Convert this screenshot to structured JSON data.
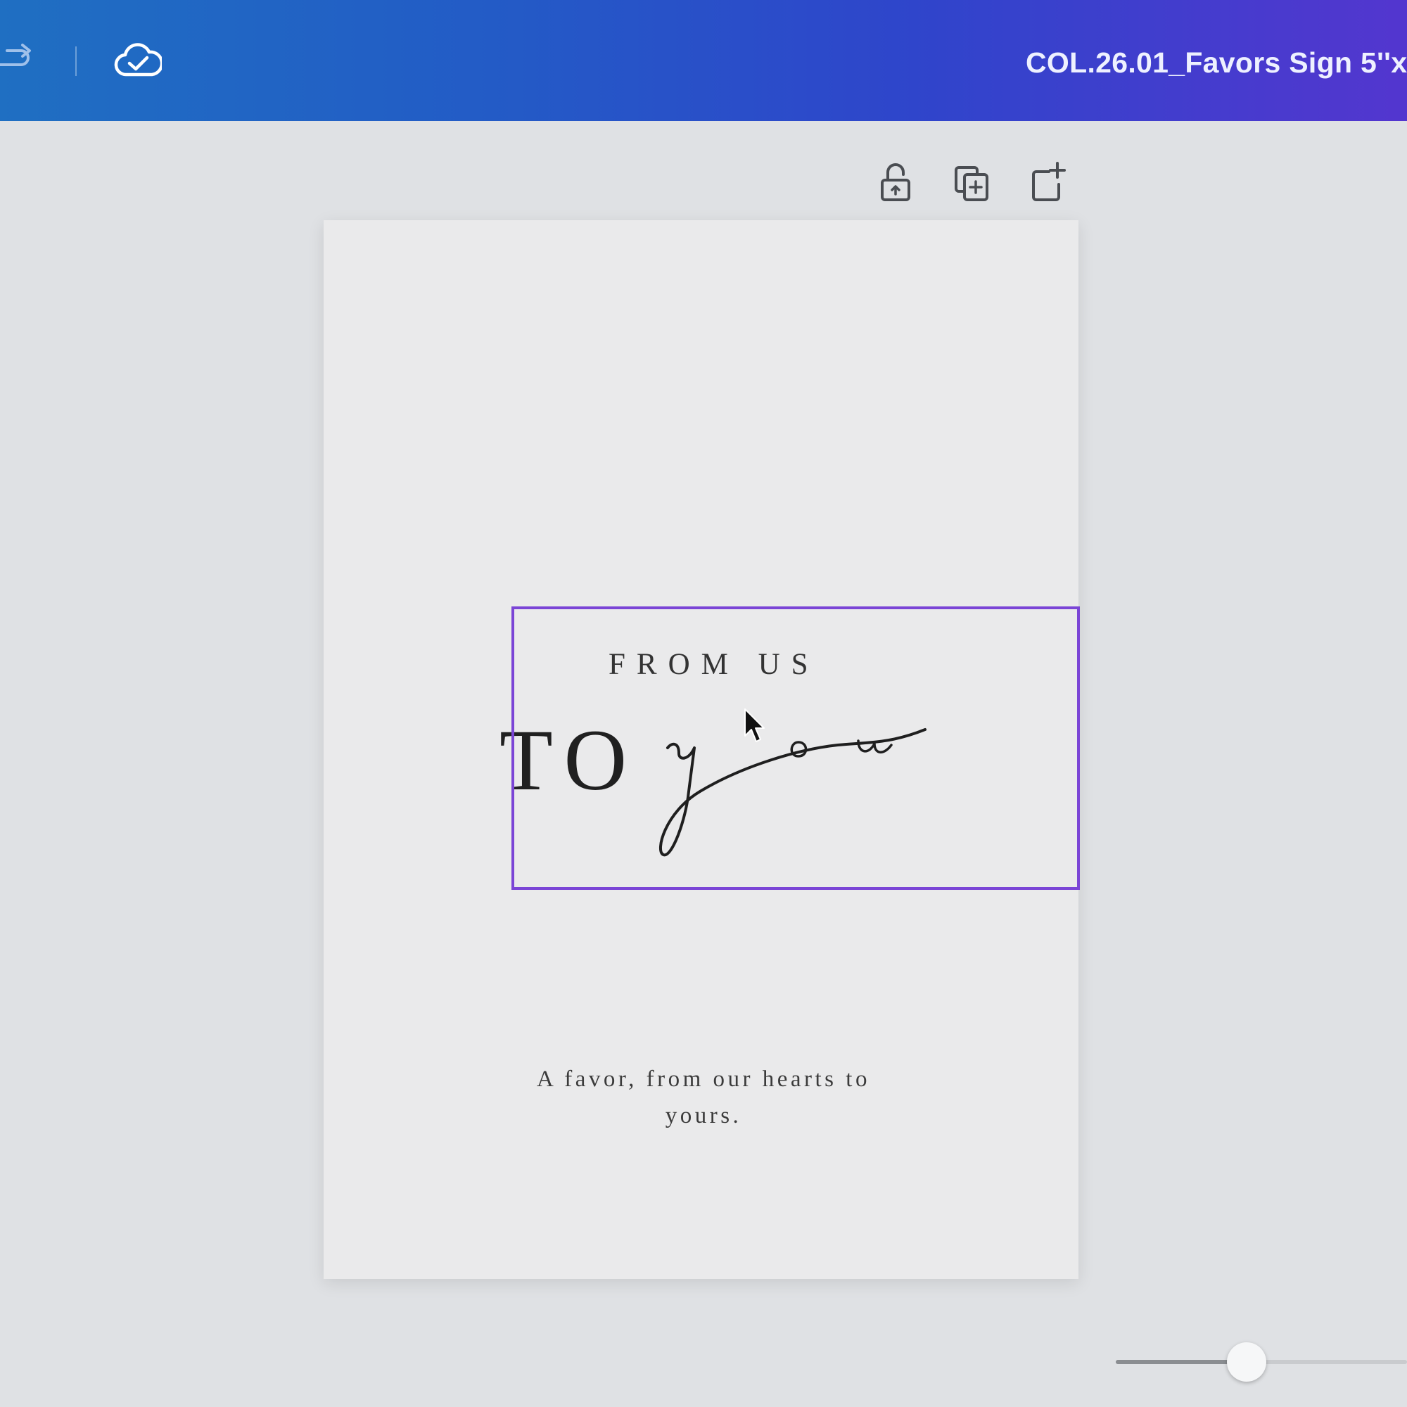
{
  "header": {
    "title": "COL.26.01_Favors Sign 5''x",
    "icons": [
      "redo-icon",
      "cloud-saved-icon"
    ]
  },
  "page_tools": {
    "icons": [
      "lock-icon",
      "duplicate-page-icon",
      "add-page-icon"
    ]
  },
  "design": {
    "heading_small": "FROM US",
    "heading_large": "TO",
    "heading_script": "you",
    "tagline_line1": "A favor, from our hearts to",
    "tagline_line2": "yours."
  },
  "zoom": {
    "slider_fraction": 0.45
  },
  "colors": {
    "header_gradient_start": "#1f6fc2",
    "header_gradient_end": "#5336cf",
    "selection": "#7b45d6",
    "canvas_background": "#dfe1e4",
    "page_background": "#eaeaeb"
  }
}
